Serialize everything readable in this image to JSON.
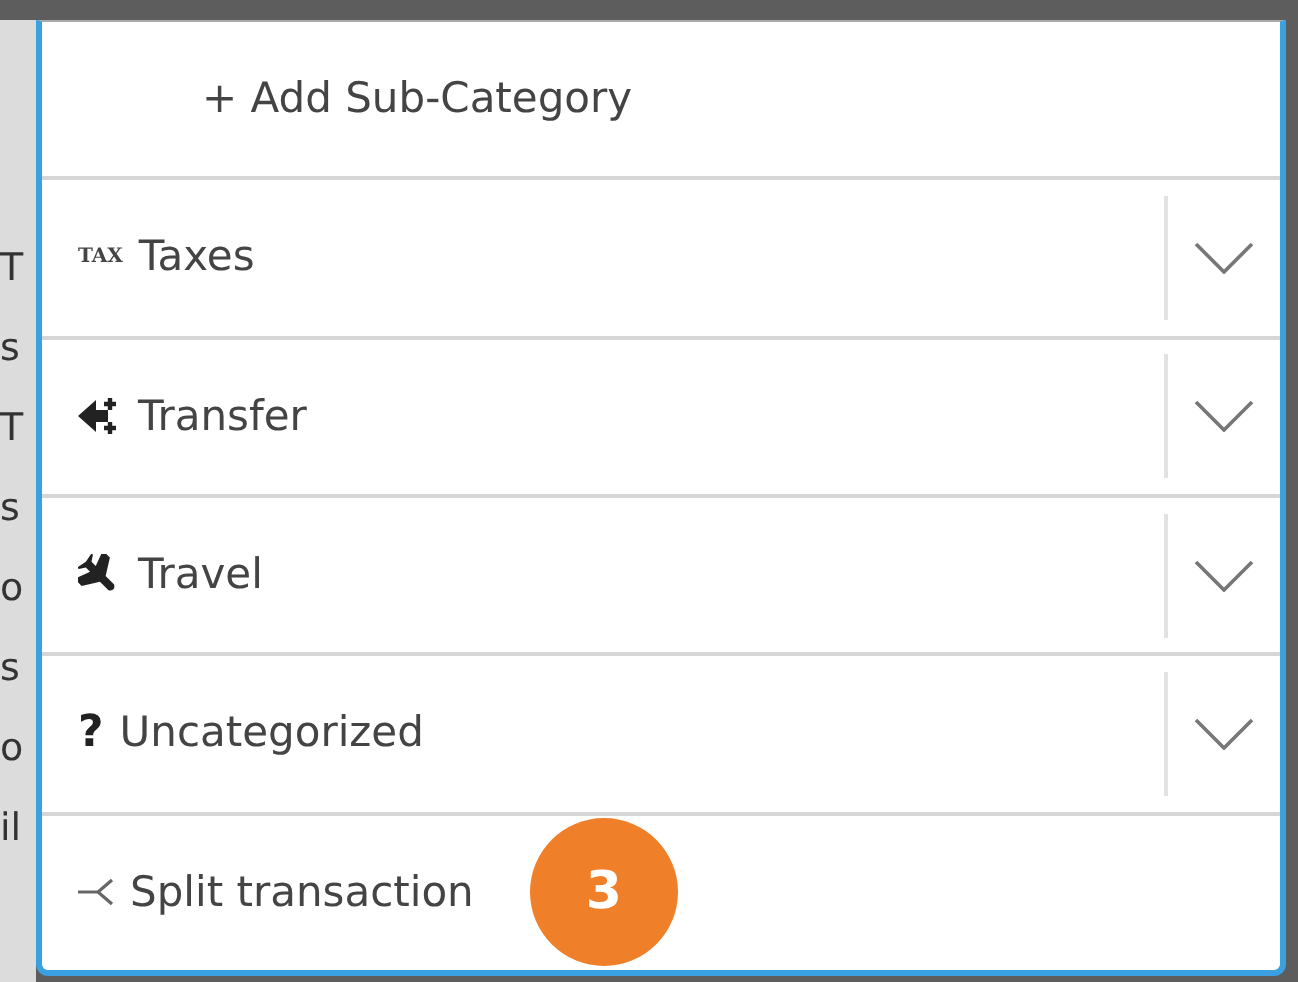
{
  "background_fragments": [
    {
      "text": "T"
    },
    {
      "text": "s"
    },
    {
      "text": "T"
    },
    {
      "text": "s"
    },
    {
      "text": "o"
    },
    {
      "text": "s"
    },
    {
      "text": "o"
    },
    {
      "text": "il"
    }
  ],
  "add_sub_category": {
    "text": "+ Add Sub-Category"
  },
  "categories": [
    {
      "label": "Taxes",
      "icon": {
        "kind": "text",
        "text": "TAX"
      },
      "expanded": false
    },
    {
      "label": "Transfer",
      "icon": {
        "kind": "transfer"
      },
      "expanded": false
    },
    {
      "label": "Travel",
      "icon": {
        "kind": "plane"
      },
      "expanded": false
    },
    {
      "label": "Uncategorized",
      "icon": {
        "kind": "text",
        "text": "?"
      },
      "expanded": false
    }
  ],
  "split": {
    "label": "Split transaction"
  },
  "step_badge": {
    "text": "3",
    "color": "#f07f2a"
  }
}
